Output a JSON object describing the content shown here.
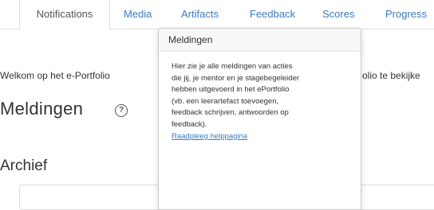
{
  "tabs": [
    {
      "label": "Notifications",
      "active": true
    },
    {
      "label": "Media",
      "active": false
    },
    {
      "label": "Artifacts",
      "active": false
    },
    {
      "label": "Feedback",
      "active": false
    },
    {
      "label": "Scores",
      "active": false
    },
    {
      "label": "Progress",
      "active": false
    }
  ],
  "welcome": {
    "left_text": "Welkom op het e-Portfolio",
    "right_text": "olio te bekijke"
  },
  "page_title": "Meldingen",
  "help_icon": {
    "icon": "question-circle-icon",
    "glyph": "?"
  },
  "popover": {
    "title": "Meldingen",
    "lines": [
      "Hier zie je alle meldingen van acties",
      "die jij, je mentor en je stagebegeleider",
      "hebben uitgevoerd in het ePortfolio",
      "(vb. een leerartefact toevoegen,",
      "feedback schrijven, antwoorden op",
      "feedback)."
    ],
    "link": "Raadpleeg helppagina"
  },
  "archive_title": "Archief",
  "colors": {
    "link": "#3a7bbf",
    "text": "#333333",
    "border": "#dddddd"
  }
}
